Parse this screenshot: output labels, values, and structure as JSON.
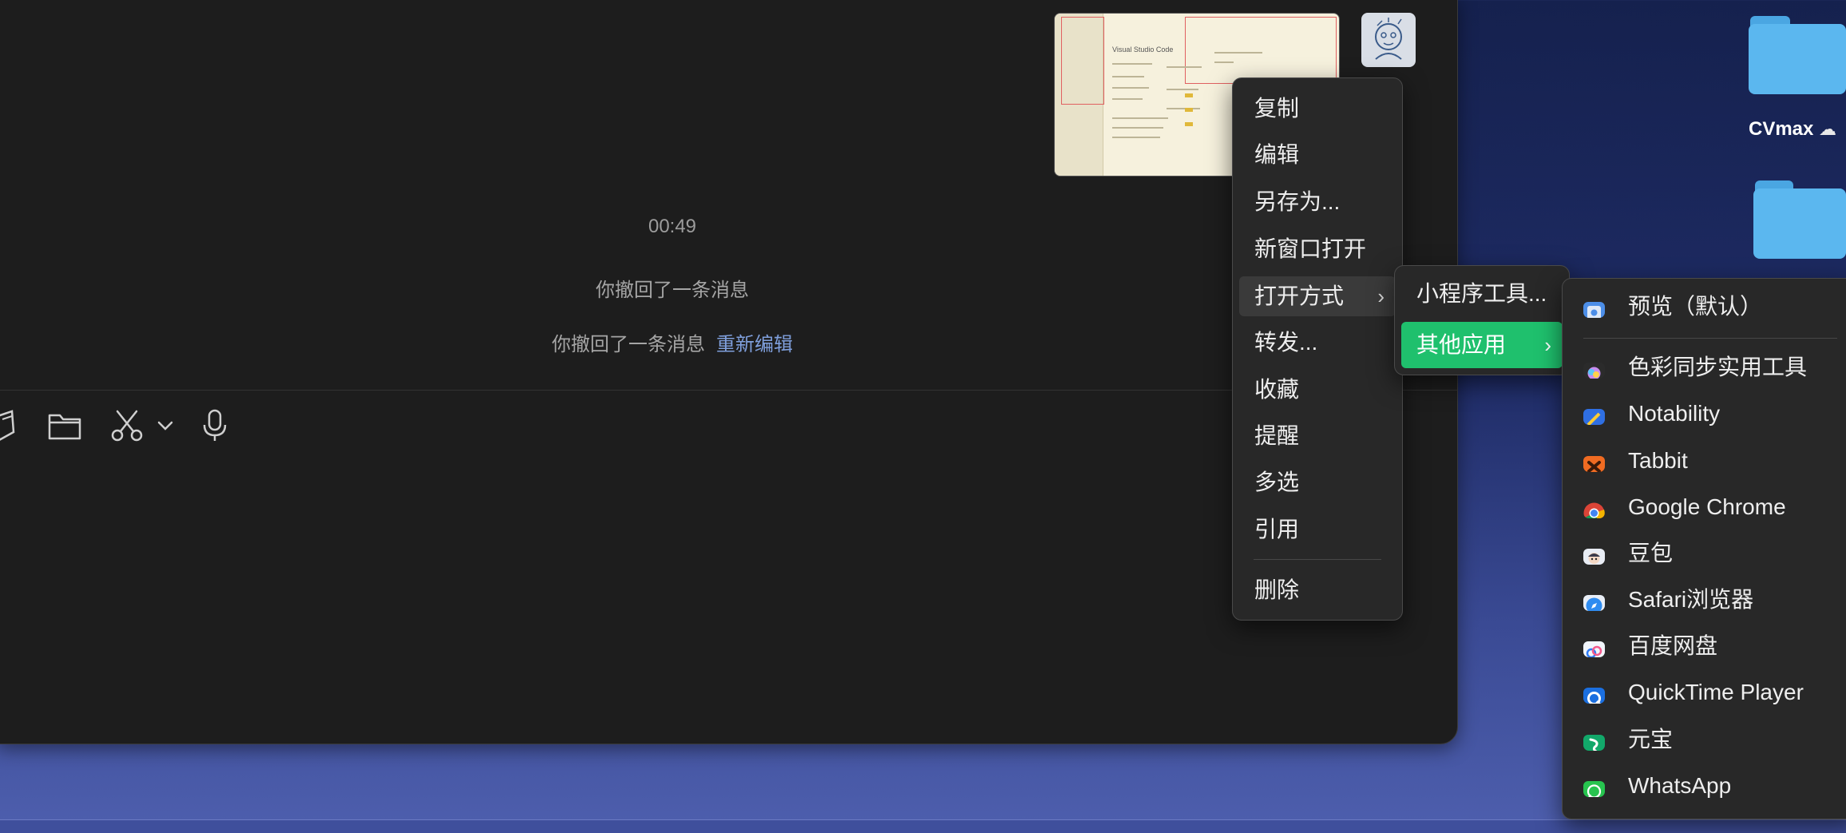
{
  "chat": {
    "timestamp": "00:49",
    "recall_notice": "你撤回了一条消息",
    "recall_notice_2": "你撤回了一条消息",
    "reedit_link": "重新编辑"
  },
  "context_menu": {
    "copy": "复制",
    "edit": "编辑",
    "save_as": "另存为...",
    "open_new_window": "新窗口打开",
    "open_with": "打开方式",
    "forward": "转发...",
    "favorite": "收藏",
    "remind": "提醒",
    "multi_select": "多选",
    "quote": "引用",
    "delete": "删除"
  },
  "open_with_menu": {
    "mini_program": "小程序工具...",
    "other_apps": "其他应用"
  },
  "apps_menu": {
    "items": [
      {
        "label": "预览（默认）",
        "icon": "preview-icon"
      },
      {
        "label": "色彩同步实用工具",
        "icon": "colorsync-icon"
      },
      {
        "label": "Notability",
        "icon": "notability-icon"
      },
      {
        "label": "Tabbit",
        "icon": "tabbit-icon"
      },
      {
        "label": "Google Chrome",
        "icon": "chrome-icon"
      },
      {
        "label": "豆包",
        "icon": "doubao-icon"
      },
      {
        "label": "Safari浏览器",
        "icon": "safari-icon"
      },
      {
        "label": "百度网盘",
        "icon": "baidu-netdisk-icon"
      },
      {
        "label": "QuickTime Player",
        "icon": "quicktime-icon"
      },
      {
        "label": "元宝",
        "icon": "yuanbao-icon"
      },
      {
        "label": "WhatsApp",
        "icon": "whatsapp-icon"
      }
    ]
  },
  "desktop": {
    "folder_label": "CVmax"
  },
  "thumbnail": {
    "title": "Visual Studio Code"
  },
  "colors": {
    "accent_green": "#1fc06d",
    "link_blue": "#7f9fdc",
    "window_bg": "#1d1d1d",
    "menu_bg": "#282828"
  }
}
